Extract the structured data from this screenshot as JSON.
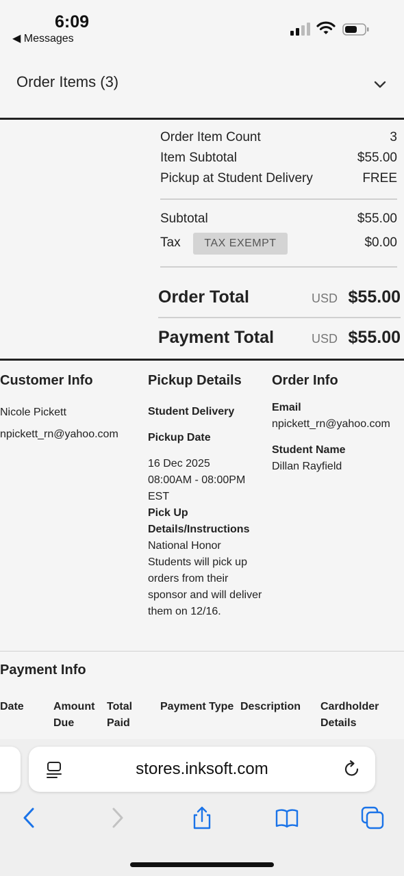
{
  "status_bar": {
    "time": "6:09",
    "back_label": "◀ Messages"
  },
  "order_items": {
    "title": "Order Items (3)"
  },
  "totals": {
    "rows": [
      {
        "label": "Order Item Count",
        "value": "3"
      },
      {
        "label": "Item Subtotal",
        "value": "$55.00"
      },
      {
        "label": "Pickup at Student Delivery",
        "value": "FREE"
      }
    ],
    "subtotal": {
      "label": "Subtotal",
      "value": "$55.00"
    },
    "tax": {
      "label": "Tax",
      "badge": "TAX EXEMPT",
      "value": "$0.00"
    },
    "order_total": {
      "label": "Order Total",
      "currency": "USD",
      "value": "$55.00"
    },
    "payment_total": {
      "label": "Payment Total",
      "currency": "USD",
      "value": "$55.00"
    }
  },
  "customer_info": {
    "heading": "Customer Info",
    "name": "Nicole Pickett",
    "email": "npickett_rn@yahoo.com"
  },
  "pickup_details": {
    "heading": "Pickup Details",
    "method": "Student Delivery",
    "date_label": "Pickup Date",
    "date": "16 Dec 2025",
    "time": "08:00AM - 08:00PM EST",
    "instructions_label": "Pick Up Details/Instructions",
    "instructions": "National Honor Students will pick up orders from their sponsor and will deliver them on 12/16."
  },
  "order_info": {
    "heading": "Order Info",
    "email_label": "Email",
    "email": "npickett_rn@yahoo.com",
    "student_label": "Student Name",
    "student": "Dillan Rayfield"
  },
  "payment_info": {
    "heading": "Payment Info",
    "columns": [
      "Date",
      "Amount Due",
      "Total Paid",
      "Payment Type",
      "Description",
      "Cardholder Details"
    ]
  },
  "browser": {
    "url": "stores.inksoft.com",
    "icons": [
      "reader-icon",
      "reload-icon",
      "back-icon",
      "forward-icon",
      "share-icon",
      "bookmarks-icon",
      "tabs-icon"
    ]
  }
}
